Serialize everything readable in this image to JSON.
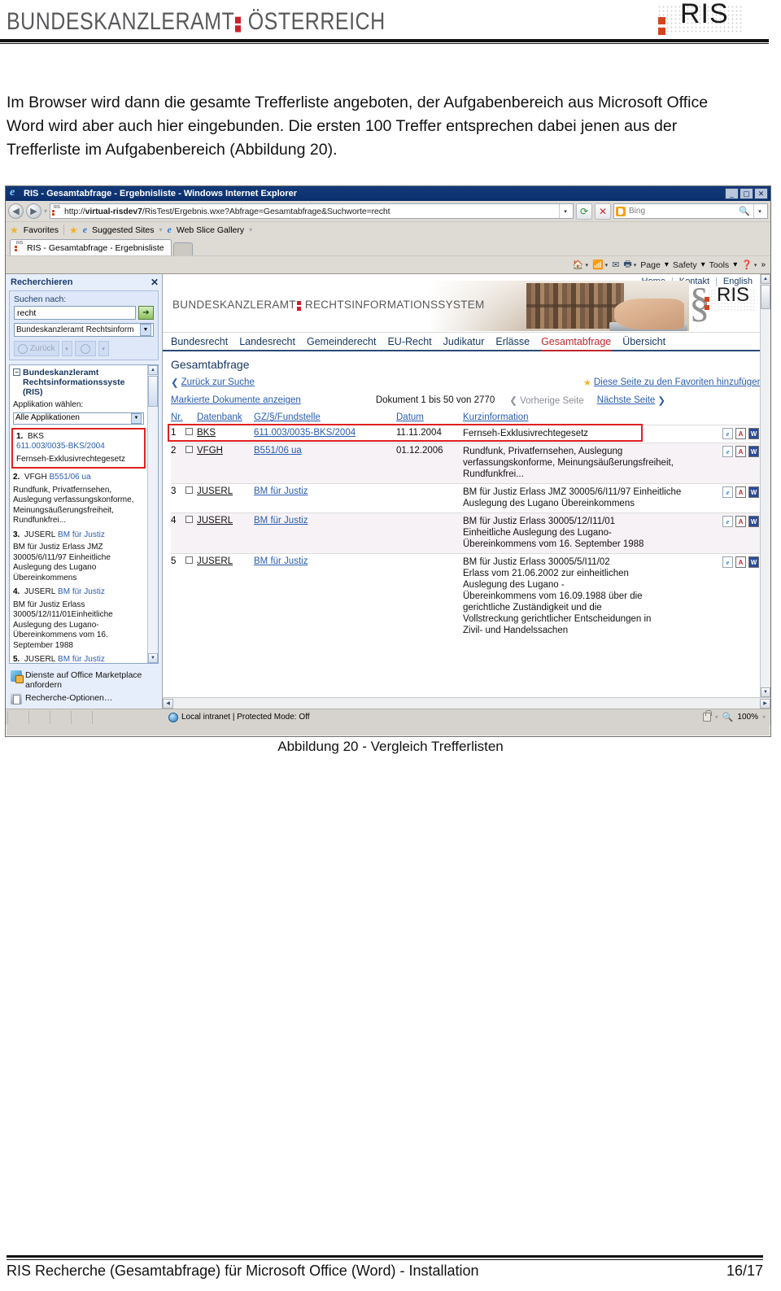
{
  "doc_header": {
    "bka_text_left": "BUNDESKANZLERAMT",
    "bka_text_right": "ÖSTERREICH",
    "ris_logo": "RIS"
  },
  "intro": {
    "paragraph": "Im Browser wird dann die gesamte Trefferliste angeboten, der Aufgabenbereich aus Microsoft Office Word wird aber auch hier eingebunden. Die ersten 100 Treffer entsprechen dabei jenen aus der Trefferliste im Aufgabenbereich (Abbildung 20)."
  },
  "browser": {
    "title": "RIS - Gesamtabfrage - Ergebnisliste - Windows Internet Explorer",
    "window_buttons": {
      "minimize": "_",
      "maximize": "▢",
      "close": "✕"
    },
    "address": {
      "url_prefix": "http://",
      "url_host": "virtual-risdev7",
      "url_rest": "/RisTest/Ergebnis.wxe?Abfrage=Gesamtabfrage&Suchworte=recht",
      "refresh_icon": "refresh-icon",
      "stop_icon": "stop-icon"
    },
    "search": {
      "provider": "Bing",
      "placeholder": "Bing"
    },
    "favorites_bar": {
      "favorites_label": "Favorites",
      "suggested_sites": "Suggested Sites",
      "web_slice_gallery": "Web Slice Gallery"
    },
    "tab": {
      "label": "RIS - Gesamtabfrage - Ergebnisliste"
    },
    "command_bar": {
      "items": [
        "Page",
        "Safety",
        "Tools"
      ],
      "icons": [
        "home-icon",
        "feeds-icon",
        "mail-icon",
        "print-icon",
        "help-icon",
        "chevron-double-right-icon"
      ]
    },
    "status_bar": {
      "zone": "Local intranet | Protected Mode: Off",
      "zoom": "100%"
    }
  },
  "taskpane": {
    "title": "Recherchieren",
    "close_label": "✕",
    "search_label": "Suchen nach:",
    "search_value": "recht",
    "go_label": "➔",
    "service_select": "Bundeskanzleramt Rechtsinform",
    "back_label": "Zurück",
    "group_title": "Bundeskanzleramt Rechtsinformationssyste (RIS)",
    "app_label": "Applikation wählen:",
    "app_value": "Alle Applikationen",
    "hits": [
      {
        "num": "1.",
        "db": "BKS",
        "ref": "611.003/0035-BKS/2004",
        "desc": "Fernseh-Exklusivrechtegesetz",
        "highlight": true
      },
      {
        "num": "2.",
        "db": "VFGH",
        "ref": "B551/06 ua",
        "desc": "Rundfunk, Privatfernsehen, Auslegung verfassungskonforme, Meinungsäußerungsfreiheit, Rundfunkfrei...",
        "highlight": false
      },
      {
        "num": "3.",
        "db": "JUSERL",
        "ref": "BM für Justiz",
        "desc": "BM für Justiz Erlass JMZ 30005/6/I11/97 Einheitliche Auslegung des Lugano Übereinkommens",
        "highlight": false
      },
      {
        "num": "4.",
        "db": "JUSERL",
        "ref": "BM für Justiz",
        "desc": "BM für Justiz Erlass 30005/12/I11/01Einheitliche Auslegung des Lugano-Übereinkommens vom 16. September 1988",
        "highlight": false
      },
      {
        "num": "5.",
        "db": "JUSERL",
        "ref": "BM für Justiz",
        "desc": "",
        "highlight": false
      }
    ],
    "footer_links": [
      {
        "label": "Dienste auf Office Marketplace anfordern",
        "icon": "marketplace-icon"
      },
      {
        "label": "Recherche-Optionen…",
        "icon": "options-icon"
      }
    ]
  },
  "ris_page": {
    "top_links": [
      "Home",
      "Kontakt",
      "English"
    ],
    "banner_left": "BUNDESKANZLERAMT",
    "banner_right": "RECHTSINFORMATIONSSYSTEM",
    "banner_logo": "RIS",
    "paragraph_symbol": "§",
    "nav_tabs": [
      {
        "label": "Bundesrecht",
        "active": false
      },
      {
        "label": "Landesrecht",
        "active": false
      },
      {
        "label": "Gemeinderecht",
        "active": false
      },
      {
        "label": "EU-Recht",
        "active": false
      },
      {
        "label": "Judikatur",
        "active": false
      },
      {
        "label": "Erlässe",
        "active": false
      },
      {
        "label": "Gesamtabfrage",
        "active": true
      },
      {
        "label": "Übersicht",
        "active": false
      }
    ],
    "heading": "Gesamtabfrage",
    "back_link": "Zurück zur Suche",
    "favorite_link": "Diese Seite zu den Favoriten hinzufügen",
    "show_marked_link": "Markierte Dokumente anzeigen",
    "doc_range": "Dokument 1 bis 50 von 2770",
    "prev_page": "Vorherige Seite",
    "next_page": "Nächste Seite",
    "table": {
      "headers": [
        "Nr.",
        "Datenbank",
        "GZ/§/Fundstelle",
        "Datum",
        "Kurzinformation"
      ],
      "header_combined": "Datenbank GZ/§/Fundstelle",
      "rows": [
        {
          "nr": "1",
          "db": "BKS",
          "ref": "611.003/0035-BKS/2004",
          "date": "11.11.2004",
          "info": "Fernseh-Exklusivrechtegesetz",
          "highlight": true,
          "icons": [
            "html-icon",
            "pdf-icon",
            "word-icon"
          ]
        },
        {
          "nr": "2",
          "db": "VFGH",
          "ref": "B551/06 ua",
          "date": "01.12.2006",
          "info": "Rundfunk, Privatfernsehen, Auslegung verfassungskonforme, Meinungsäußerungsfreiheit, Rundfunkfrei...",
          "highlight": false,
          "icons": [
            "html-icon",
            "pdf-icon",
            "word-icon"
          ]
        },
        {
          "nr": "3",
          "db": "JUSERL",
          "ref": "BM für Justiz",
          "date": "",
          "info": "BM für Justiz Erlass JMZ 30005/6/I11/97 Einheitliche\nAuslegung des Lugano Übereinkommens",
          "highlight": false,
          "icons": [
            "html-icon",
            "pdf-icon",
            "word-icon"
          ]
        },
        {
          "nr": "4",
          "db": "JUSERL",
          "ref": "BM für Justiz",
          "date": "",
          "info": "BM für Justiz Erlass 30005/12/I11/01\nEinheitliche Auslegung des Lugano-\nÜbereinkommens vom 16. September 1988",
          "highlight": false,
          "icons": [
            "html-icon",
            "pdf-icon",
            "word-icon"
          ]
        },
        {
          "nr": "5",
          "db": "JUSERL",
          "ref": "BM für Justiz",
          "date": "",
          "info": "BM für Justiz Erlass 30005/5/I11/02\nErlass vom 21.06.2002 zur einheitlichen\nAuslegung des Lugano -\nÜbereinkommens vom 16.09.1988 über die\ngerichtliche Zuständigkeit und die\nVollstreckung gerichtlicher Entscheidungen in\nZivil- und Handelssachen",
          "highlight": false,
          "icons": [
            "html-icon",
            "pdf-icon",
            "word-icon"
          ]
        }
      ]
    }
  },
  "caption": "Abbildung 20 - Vergleich Trefferlisten",
  "footer": {
    "text": "RIS Recherche (Gesamtabfrage) für Microsoft Office (Word) - Installation",
    "page": "16/17"
  },
  "colors": {
    "accent_red": "#c0272d",
    "link_blue": "#2a5db0",
    "highlight_red": "#e02020",
    "brand_orange": "#d4451f",
    "title_blue": "#123a7a"
  }
}
